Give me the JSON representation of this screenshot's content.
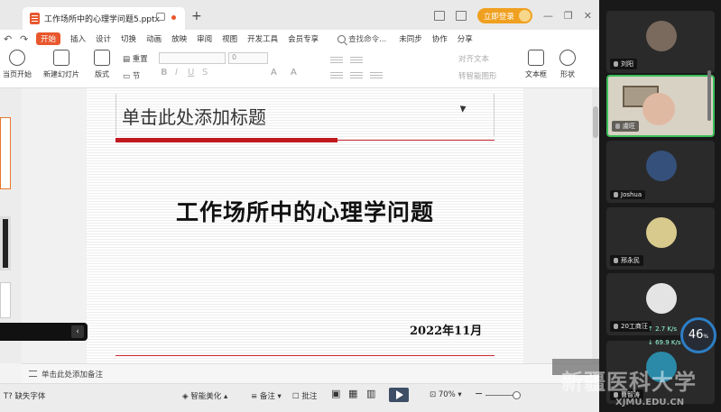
{
  "titlebar": {
    "tab_title": "工作场所中的心理学问题5.pptx",
    "login_label": "立即登录"
  },
  "menu": {
    "tabs": [
      "开始",
      "插入",
      "设计",
      "切换",
      "动画",
      "放映",
      "审阅",
      "视图",
      "开发工具",
      "会员专享"
    ],
    "search_label": "查找命令...",
    "sync_label": "未同步",
    "collab_label": "协作",
    "share_label": "分享"
  },
  "ribbon": {
    "from_start": "当页开始",
    "new_slide": "新建幻灯片",
    "layout": "版式",
    "section": "节",
    "reset": "重置",
    "font_size": "0",
    "align_text": "对齐文本",
    "smartart": "转智能图形",
    "textbox": "文本框",
    "shape": "形状"
  },
  "slide": {
    "title_placeholder": "单击此处添加标题",
    "main_title": "工作场所中的心理学问题",
    "date": "2022年11月"
  },
  "notes": {
    "placeholder": "单击此处添加备注"
  },
  "status": {
    "missing_font": "缺失字体",
    "beautify": "智能美化",
    "notes": "备注",
    "comments": "批注",
    "zoom": "70%"
  },
  "participants": [
    {
      "name": "刘阳",
      "color": "#7a6a5e",
      "active": false
    },
    {
      "name": "虞旺",
      "color": "#cfc6b5",
      "active": true
    },
    {
      "name": "Joshua",
      "color": "#35507a",
      "active": false
    },
    {
      "name": "邢永民",
      "color": "#d8c98c",
      "active": false
    },
    {
      "name": "20工商汪",
      "color": "#e4e4e4",
      "active": false
    },
    {
      "name": "曹智涛",
      "color": "#2a8aa8",
      "active": false
    }
  ],
  "network": {
    "up": "2.7",
    "down": "69.9",
    "unit": "K/s",
    "cpu": "46",
    "cpu_unit": "%"
  },
  "watermark": {
    "text": "新疆医科大学",
    "sub": "XJMU.EDU.CN"
  }
}
